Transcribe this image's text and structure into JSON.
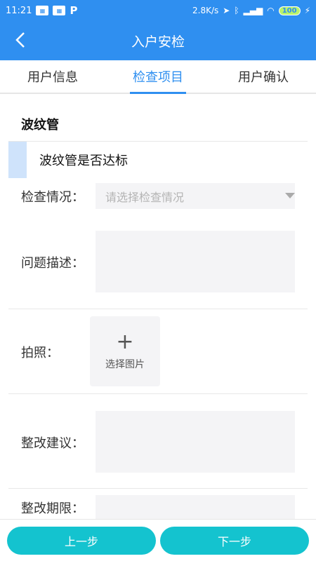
{
  "status_bar": {
    "time": "11:21",
    "left_icons": [
      "app-icon-1",
      "app-icon-2",
      "p-icon"
    ],
    "network_speed": "2.8K/s",
    "battery": "100"
  },
  "nav": {
    "title": "入户安检",
    "back_icon": "chevron-left-icon"
  },
  "tabs": [
    {
      "label": "用户信息",
      "active": false
    },
    {
      "label": "检查项目",
      "active": true
    },
    {
      "label": "用户确认",
      "active": false
    }
  ],
  "section": {
    "title": "波纹管",
    "item_title": "波纹管是否达标",
    "fields": {
      "inspection_label": "检查情况：",
      "inspection_placeholder": "请选择检查情况",
      "problem_label": "问题描述：",
      "photo_label": "拍照：",
      "photo_button_label": "选择图片",
      "suggestion_label": "整改建议：",
      "deadline_label": "整改期限："
    }
  },
  "buttons": {
    "prev": "上一步",
    "next": "下一步"
  },
  "colors": {
    "primary": "#2f8ff0",
    "button": "#14c3cf",
    "field_bg": "#f4f4f6",
    "marker": "#cfe3fb"
  }
}
